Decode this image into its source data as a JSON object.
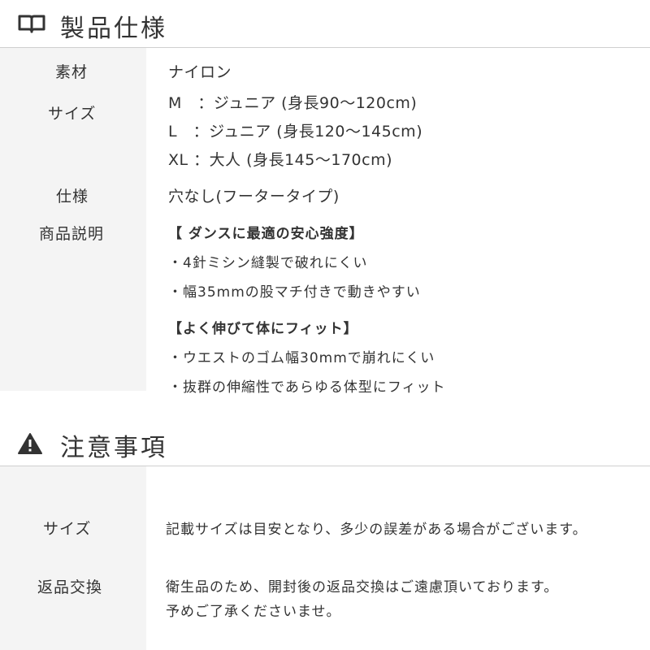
{
  "spec": {
    "title": "製品仕様",
    "icon": "open-book-icon",
    "rows": {
      "material_label": "素材",
      "material_value": "ナイロン",
      "size_label": "サイズ",
      "sizes": [
        "M　：ジュニア (身長90〜120cm)",
        "L　：ジュニア (身長120〜145cm)",
        "XL ：大人  (身長145〜170cm)"
      ],
      "spec_label": "仕様",
      "spec_value": "穴なし(フータータイプ)",
      "desc_label": "商品説明",
      "desc_heading1": "【 ダンスに最適の安心強度】",
      "desc_bullets1": [
        "・4針ミシン縫製で破れにくい",
        "・幅35mmの股マチ付きで動きやすい"
      ],
      "desc_heading2": "【よく伸びて体にフィット】",
      "desc_bullets2": [
        "・ウエストのゴム幅30mmで崩れにくい",
        "・抜群の伸縮性であらゆる体型にフィット"
      ]
    }
  },
  "caution": {
    "title": "注意事項",
    "icon": "warning-icon",
    "size_label": "サイズ",
    "size_note": "記載サイズは目安となり、多少の誤差がある場合がございます。",
    "return_label": "返品交換",
    "return_note_lines": [
      "衛生品のため、開封後の返品交換はご遠慮頂いております。",
      "予めご了承くださいませ。"
    ]
  }
}
